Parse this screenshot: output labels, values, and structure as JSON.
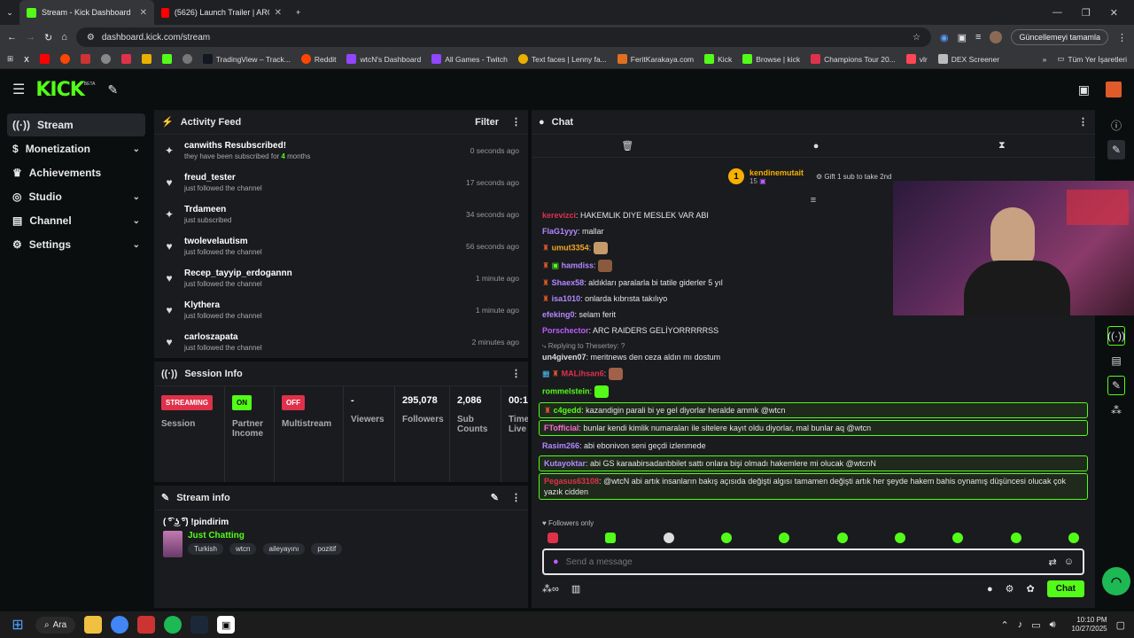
{
  "browser": {
    "tabs": [
      {
        "title": "Stream - Kick Dashboard",
        "icon": "kick-icon"
      },
      {
        "title": "(5626) Launch Trailer | ARC Raid",
        "icon": "youtube-icon"
      }
    ],
    "url": "dashboard.kick.com/stream",
    "update_label": "Güncellemeyi tamamla",
    "bookmarks": [
      "TradingView – Track...",
      "Reddit",
      "wtcN's Dashboard",
      "All Games - Twitch",
      "Text faces | Lenny fa...",
      "FeritKarakaya.com",
      "Kick",
      "Browse | kick",
      "Champions Tour 20...",
      "vlr",
      "DEX Screener"
    ],
    "all_bookmarks": "Tüm Yer İşaretleri"
  },
  "kick": {
    "logo": "KICK",
    "beta": "BETA"
  },
  "sidebar": {
    "items": [
      {
        "label": "Stream",
        "icon": "stream-icon"
      },
      {
        "label": "Monetization",
        "icon": "dollar-icon"
      },
      {
        "label": "Achievements",
        "icon": "trophy-icon"
      },
      {
        "label": "Studio",
        "icon": "studio-icon"
      },
      {
        "label": "Channel",
        "icon": "channel-icon"
      },
      {
        "label": "Settings",
        "icon": "gear-icon"
      }
    ]
  },
  "activity": {
    "title": "Activity Feed",
    "filter": "Filter",
    "items": [
      {
        "name": "canwiths Resubscribed!",
        "sub": "they have been subscribed for",
        "sub_num": "4",
        "sub_tail": "months",
        "time": "0 seconds ago",
        "icon": "sparkle-icon"
      },
      {
        "name": "freud_tester",
        "sub": "just followed the channel",
        "time": "17 seconds ago",
        "icon": "heart-icon"
      },
      {
        "name": "Trdameen",
        "sub": "just subscribed",
        "time": "34 seconds ago",
        "icon": "sparkle-icon"
      },
      {
        "name": "twolevelautism",
        "sub": "just followed the channel",
        "time": "56 seconds ago",
        "icon": "heart-icon"
      },
      {
        "name": "Recep_tayyip_erdogannn",
        "sub": "just followed the channel",
        "time": "1 minute ago",
        "icon": "heart-icon"
      },
      {
        "name": "Klythera",
        "sub": "just followed the channel",
        "time": "1 minute ago",
        "icon": "heart-icon"
      },
      {
        "name": "carloszapata",
        "sub": "just followed the channel",
        "time": "2 minutes ago",
        "icon": "heart-icon"
      }
    ]
  },
  "session": {
    "title": "Session Info",
    "cells": [
      {
        "value": "STREAMING",
        "label": "Session",
        "badge_color": "#e0314b"
      },
      {
        "value": "ON",
        "label": "Partner Income",
        "badge_color": "#53fc18"
      },
      {
        "value": "OFF",
        "label": "Multistream",
        "badge_color": "#e0314b"
      },
      {
        "value": "-",
        "label": "Viewers"
      },
      {
        "value": "295,078",
        "label": "Followers"
      },
      {
        "value": "2,086",
        "label": "Sub Counts"
      },
      {
        "value": "00:1",
        "label": "Time Live"
      }
    ]
  },
  "streaminfo": {
    "title": "Stream info",
    "stream_title": "( ͡° ͜ʖ ͡°) !pindirim",
    "category": "Just Chatting",
    "tags": [
      "Turkish",
      "wtcn",
      "aileyayını",
      "pozitif"
    ]
  },
  "chat": {
    "title": "Chat",
    "top_gifter": {
      "rank": "1",
      "name": "kendinemutait",
      "count": "15"
    },
    "gift_prompt": "Gift 1 sub to take 2nd",
    "reply_to": "Replying to Thesertey: ?",
    "messages": [
      {
        "user": "kerevizci",
        "color": "#e0314b",
        "text": "HAKEMLIK DIYE MESLEK VAR ABI"
      },
      {
        "user": "FlaG1yyy",
        "color": "#b388ff",
        "text": "mallar"
      },
      {
        "user": "umut3354",
        "color": "#f5a623",
        "text": "",
        "emote": "#c69a6a"
      },
      {
        "user": "hamdiss",
        "color": "#b388ff",
        "text": "",
        "emote": "#8a5a3c"
      },
      {
        "user": "Shaex58",
        "color": "#b388ff",
        "text": "aldıkları paralarla bi tatile giderler 5 yıl"
      },
      {
        "user": "isa1010",
        "color": "#b388ff",
        "text": "onlarda kıbrısta takılıyo"
      },
      {
        "user": "efeking0",
        "color": "#b388ff",
        "text": "selam ferit"
      },
      {
        "user": "Porschector",
        "color": "#c15cff",
        "text": "ARC RAIDERS GELİYORRRRRSS"
      },
      {
        "user": "un4given07",
        "color": "#ddd",
        "text": "meritnews den ceza aldın mı dostum"
      },
      {
        "user": "MALihsan6",
        "color": "#e0314b",
        "text": "",
        "emote": "#a0604a"
      },
      {
        "user": "rommelstein",
        "color": "#53fc18",
        "text": "",
        "emote": "#53fc18"
      },
      {
        "user": "c4gedd",
        "color": "#53fc18",
        "text": "kazandigin parali bi ye gel diyorlar heralde ammk @wtcn",
        "hl": true
      },
      {
        "user": "FTofficial",
        "color": "#ff6ad5",
        "text": "bunlar kendi kimlik numaraları ile sitelere kayıt oldu diyorlar, mal bunlar aq @wtcn",
        "hl": true
      },
      {
        "user": "Rasim266",
        "color": "#b388ff",
        "text": "abi ebonivon seni geçdi izlenmede"
      },
      {
        "user": "Kutayoktar",
        "color": "#b388ff",
        "text": "abi GS karaabirsadanbbilet sattı onlara bişi olmadı hakemlere mi olucak @wtcnN",
        "hl": true
      },
      {
        "user": "Pegasus63108",
        "color": "#e0314b",
        "text": "@wtcN abi artık insanların bakış açısıda değişti algısı tamamen değişti artık her şeyde hakem bahis oynamış düşüncesi olucak çok yazık cidden",
        "hl": true
      }
    ],
    "followers_only": "Followers only",
    "placeholder": "Send a message",
    "send": "Chat"
  },
  "taskbar": {
    "search": "Ara",
    "time": "10:10 PM",
    "date": "10/27/2025"
  },
  "colors": {
    "accent": "#53fc18",
    "bg": "#0b0e0f",
    "panel": "#191b1f"
  }
}
